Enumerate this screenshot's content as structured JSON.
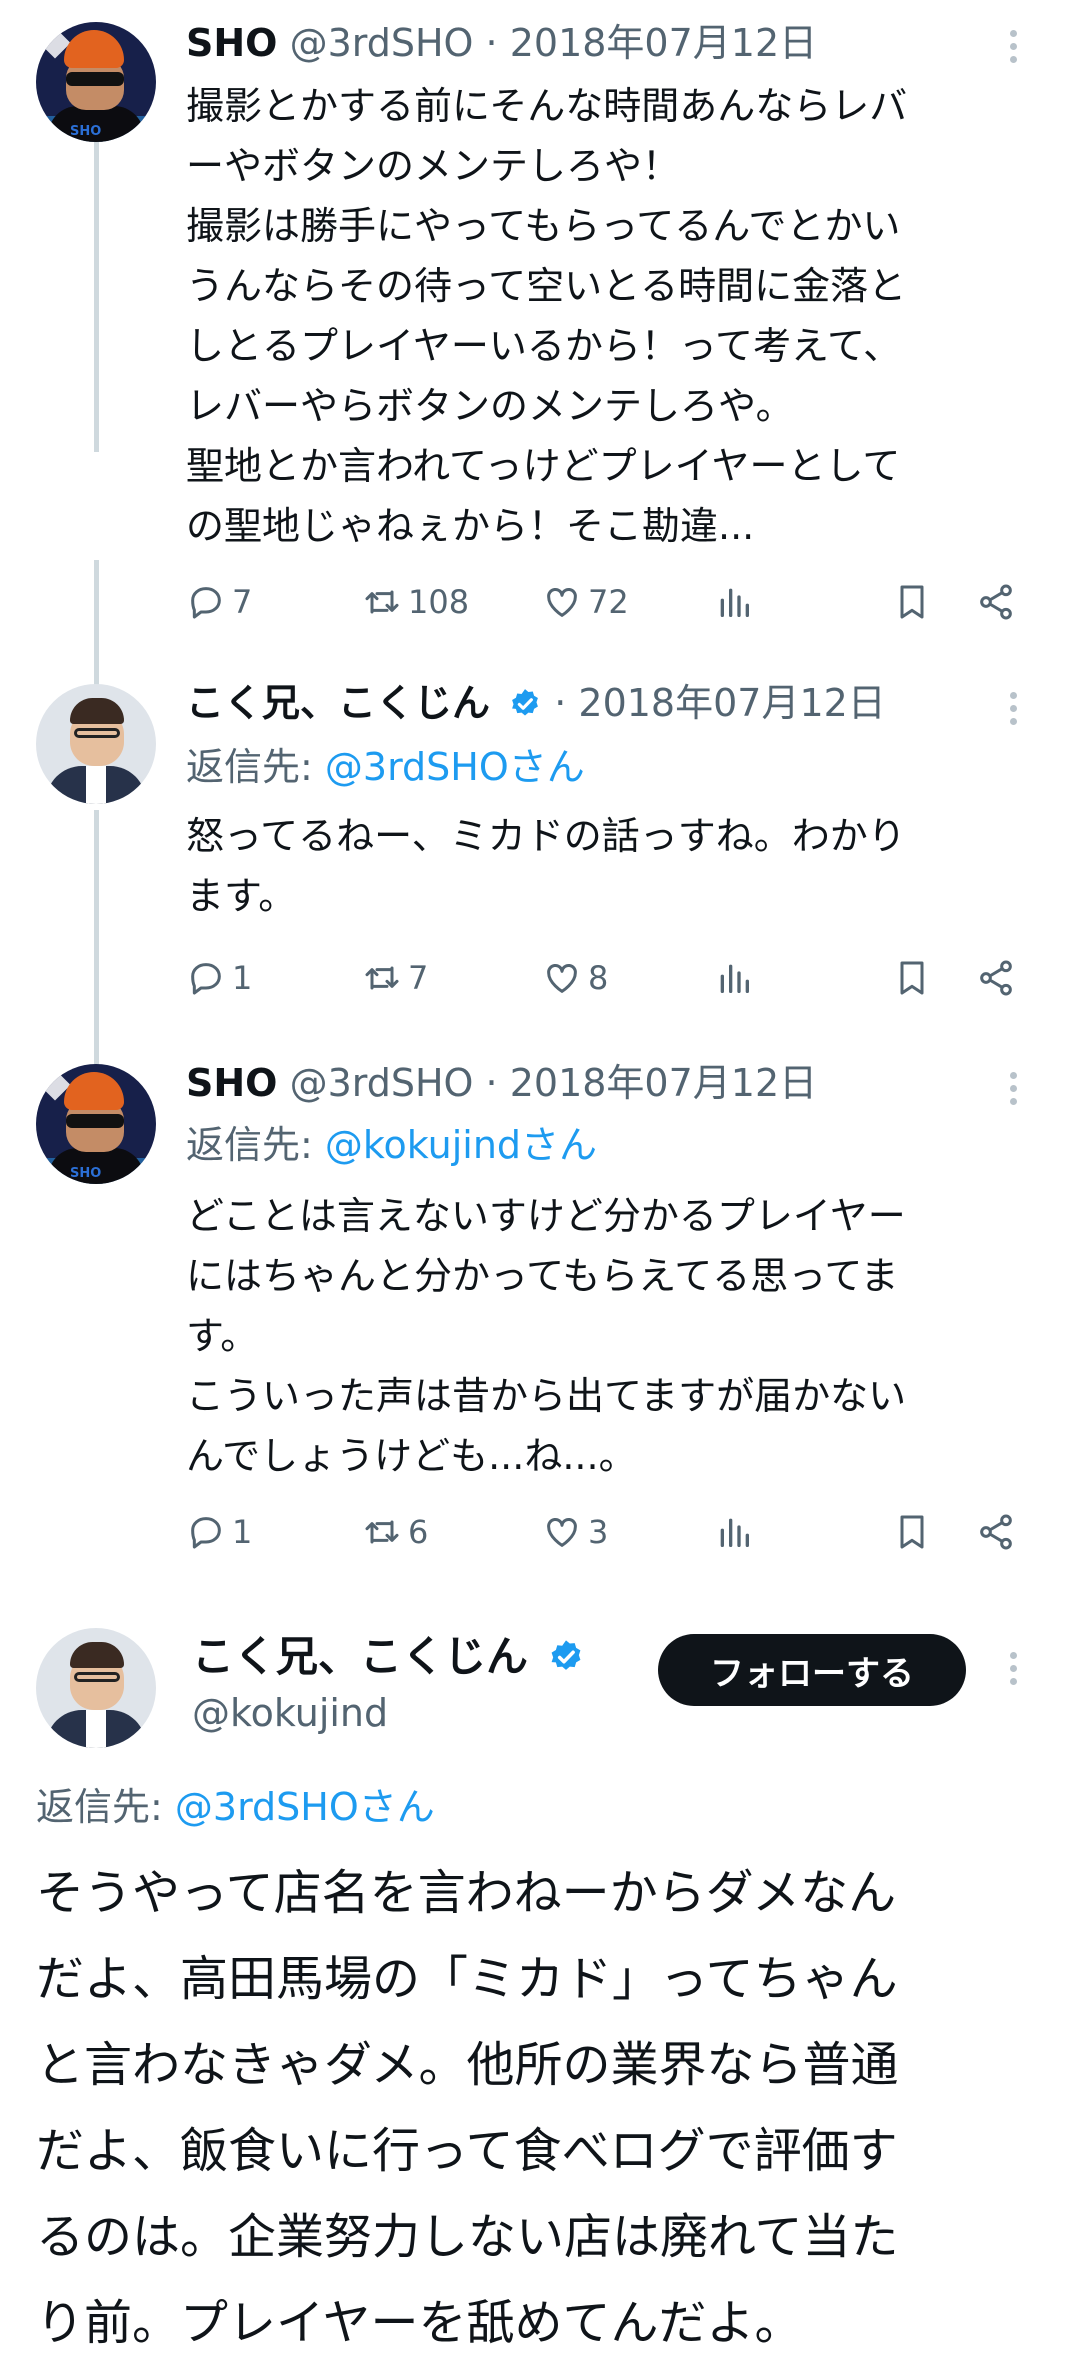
{
  "tweets": [
    {
      "name": "SHO",
      "handle": "@3rdSHO",
      "sep": "·",
      "date": "2018年07月12日",
      "avatar_label": "SHO",
      "text": "撮影とかする前にそんな時間あんならレバ\nーやボタンのメンテしろや！\n撮影は勝手にやってもらってるんでとかい\nうんならその待って空いとる時間に金落と\nしとるプレイヤーいるから！って考えて、\nレバーやらボタンのメンテしろや。\n聖地とか言われてっけどプレイヤーとして\nの聖地じゃねぇから！そこ勘違...",
      "replies": "7",
      "retweets": "108",
      "likes": "72"
    },
    {
      "name": "こく兄、こくじん",
      "sep": "·",
      "date": "2018年07月12日",
      "reply_label": "返信先: ",
      "reply_target": "@3rdSHOさん",
      "text": "怒ってるねー、ミカドの話っすね。わかり\nます。",
      "replies": "1",
      "retweets": "7",
      "likes": "8"
    },
    {
      "name": "SHO",
      "handle": "@3rdSHO",
      "sep": "·",
      "date": "2018年07月12日",
      "avatar_label": "SHO",
      "reply_label": "返信先: ",
      "reply_target": "@kokujindさん",
      "text": "どことは言えないすけど分かるプレイヤー\nにはちゃんと分かってもらえてる思ってま\nす。\nこういった声は昔から出てますが届かない\nんでしょうけども...ね...。",
      "replies": "1",
      "retweets": "6",
      "likes": "3"
    }
  ],
  "main_tweet": {
    "name": "こく兄、こくじん",
    "handle": "@kokujind",
    "follow_label": "フォローする",
    "reply_label": "返信先: ",
    "reply_target": "@3rdSHOさん",
    "text": "そうやって店名を言わねーからダメなん\nだよ、高田馬場の「ミカド」ってちゃん\nと言わなきゃダメ。他所の業界なら普通\nだよ、飯食いに行って食べログで評価す\nるのは。企業努力しない店は廃れて当た\nり前。プレイヤーを舐めてんだよ。"
  },
  "icons": [
    "reply-icon",
    "retweet-icon",
    "like-icon",
    "views-icon",
    "bookmark-icon",
    "share-icon",
    "more-icon",
    "verified-icon"
  ],
  "colors": {
    "link": "#1d9bf0",
    "muted": "#536471",
    "verified": "#1d9bf0",
    "button": "#0f1419"
  }
}
